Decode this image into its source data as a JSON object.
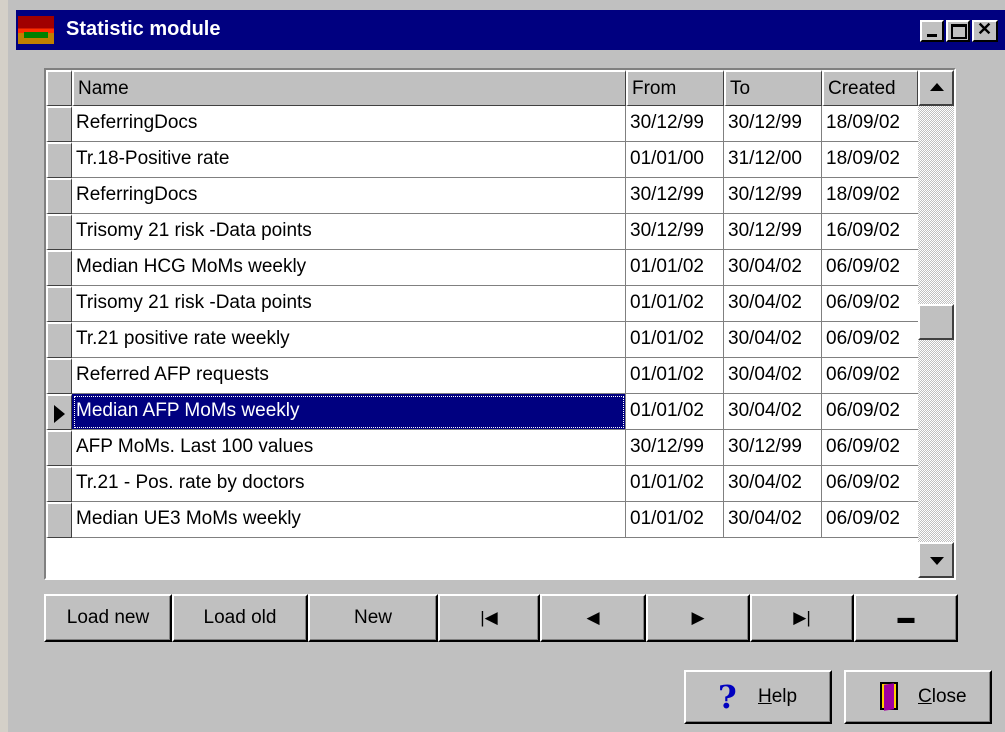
{
  "window": {
    "title": "Statistic module"
  },
  "grid": {
    "columns": [
      "Name",
      "From",
      "To",
      "Created"
    ],
    "rows": [
      {
        "name": "ReferringDocs",
        "from": "30/12/99",
        "to": "30/12/99",
        "created": "18/09/02"
      },
      {
        "name": "Tr.18-Positive rate",
        "from": "01/01/00",
        "to": "31/12/00",
        "created": "18/09/02"
      },
      {
        "name": "ReferringDocs",
        "from": "30/12/99",
        "to": "30/12/99",
        "created": "18/09/02"
      },
      {
        "name": "Trisomy 21 risk -Data points",
        "from": "30/12/99",
        "to": "30/12/99",
        "created": "16/09/02"
      },
      {
        "name": "Median HCG MoMs weekly",
        "from": "01/01/02",
        "to": "30/04/02",
        "created": "06/09/02"
      },
      {
        "name": "Trisomy 21 risk -Data points",
        "from": "01/01/02",
        "to": "30/04/02",
        "created": "06/09/02"
      },
      {
        "name": "Tr.21 positive rate weekly",
        "from": "01/01/02",
        "to": "30/04/02",
        "created": "06/09/02"
      },
      {
        "name": "Referred AFP requests",
        "from": "01/01/02",
        "to": "30/04/02",
        "created": "06/09/02"
      },
      {
        "name": "Median AFP MoMs weekly",
        "from": "01/01/02",
        "to": "30/04/02",
        "created": "06/09/02"
      },
      {
        "name": "AFP MoMs. Last 100 values",
        "from": "30/12/99",
        "to": "30/12/99",
        "created": "06/09/02"
      },
      {
        "name": "Tr.21 - Pos. rate by doctors",
        "from": "01/01/02",
        "to": "30/04/02",
        "created": "06/09/02"
      },
      {
        "name": "Median UE3 MoMs weekly",
        "from": "01/01/02",
        "to": "30/04/02",
        "created": "06/09/02"
      }
    ],
    "selected_index": 8
  },
  "toolbar": {
    "load_new": "Load new",
    "load_old": "Load old",
    "new": "New",
    "first": "|◀",
    "prior": "◀",
    "next": "▶",
    "last": "▶|",
    "delete": "▬"
  },
  "dialog": {
    "help_pre": "",
    "help_ul": "H",
    "help_post": "elp",
    "close_pre": "",
    "close_ul": "C",
    "close_post": "lose"
  },
  "icons": {
    "app": "statistic-app-icon",
    "help": "question-mark-icon",
    "close": "door-exit-icon"
  },
  "colors": {
    "titlebar": "#000080",
    "selection": "#000080",
    "face": "#c0c0c0"
  }
}
